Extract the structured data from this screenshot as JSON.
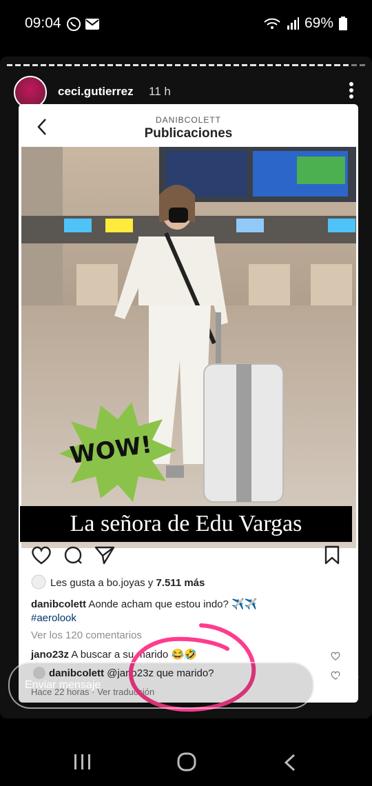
{
  "status_bar": {
    "time": "09:04",
    "battery": "69%"
  },
  "story": {
    "username": "ceci.gutierrez",
    "time_ago": "11 h"
  },
  "post": {
    "account": "DANIBCOLETT",
    "title": "Publicaciones",
    "sticker_text": "WOW!",
    "banner_text": "La señora de Edu Vargas",
    "likes_prefix": "Les gusta a ",
    "likes_user": "bo.joyas",
    "likes_mid": " y ",
    "likes_count": "7.511 más",
    "caption_user": "danibcolett",
    "caption_text": " Aonde acham que estou indo? ✈️✈️",
    "caption_tag": "#aerolook",
    "view_comments": "Ver los 120 comentarios",
    "comment1_user": "jano23z",
    "comment1_text": " A buscar a su marido 😂🤣",
    "comment2_user": "danibcolett",
    "comment2_text": " @jano23z que marido?",
    "meta": "Hace 22 horas · Ver traducción"
  },
  "message_bar": {
    "placeholder": "Enviar mensaje"
  },
  "colors": {
    "highlight_circle": "#ff3b8d",
    "sticker": "#8bc34a",
    "link": "#00376b"
  }
}
